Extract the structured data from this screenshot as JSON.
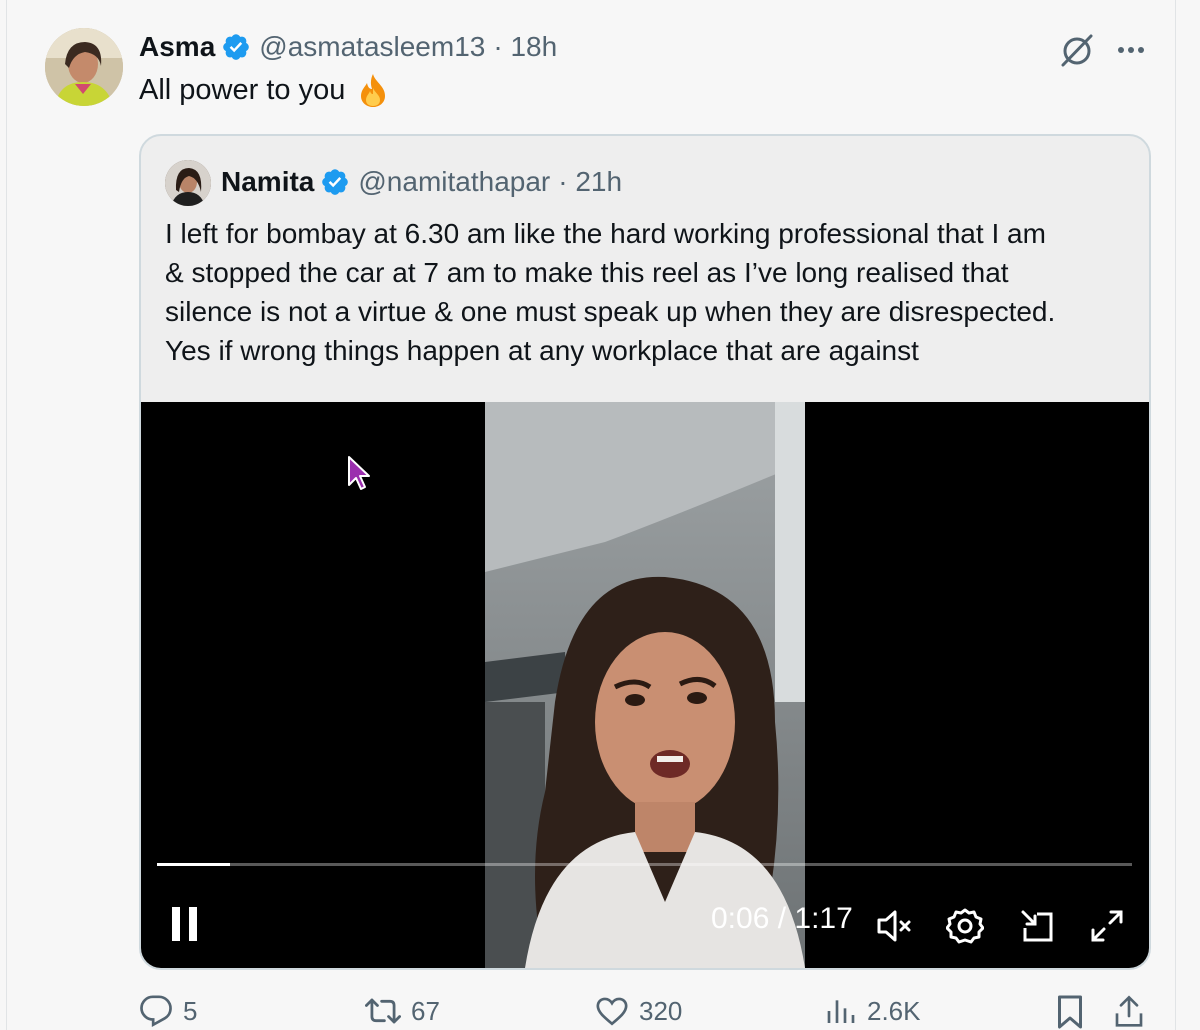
{
  "author": {
    "name": "Asma",
    "handle": "@asmatasleem13",
    "time": "· 18h",
    "text": "All power to you"
  },
  "quoted": {
    "name": "Namita",
    "handle": "@namitathapar",
    "time": "· 21h",
    "lines": [
      "I left for bombay at 6.30 am like the hard working professional that I am",
      "& stopped the car at 7 am to make this reel as I’ve long realised that",
      "silence is not a virtue & one must speak up when they are disrespected.",
      "Yes if wrong things happen at any workplace that are against"
    ]
  },
  "video": {
    "current_time": "0:06",
    "separator": " / ",
    "duration": "1:17",
    "progress_fraction": 0.075,
    "state": "playing",
    "muted": true
  },
  "actions": {
    "replies": "5",
    "reposts": "67",
    "likes": "320",
    "views": "2.6K"
  },
  "colors": {
    "verified_blue": "#1d9bf0",
    "secondary_text": "#536471",
    "cursor_purple": "#9b2fae"
  },
  "icons": [
    "verified-badge-icon",
    "fire-emoji-icon",
    "grok-icon",
    "more-icon",
    "pause-icon",
    "mute-icon",
    "settings-icon",
    "dock-icon",
    "fullscreen-icon",
    "reply-icon",
    "repost-icon",
    "like-icon",
    "views-icon",
    "bookmark-icon",
    "share-icon"
  ]
}
